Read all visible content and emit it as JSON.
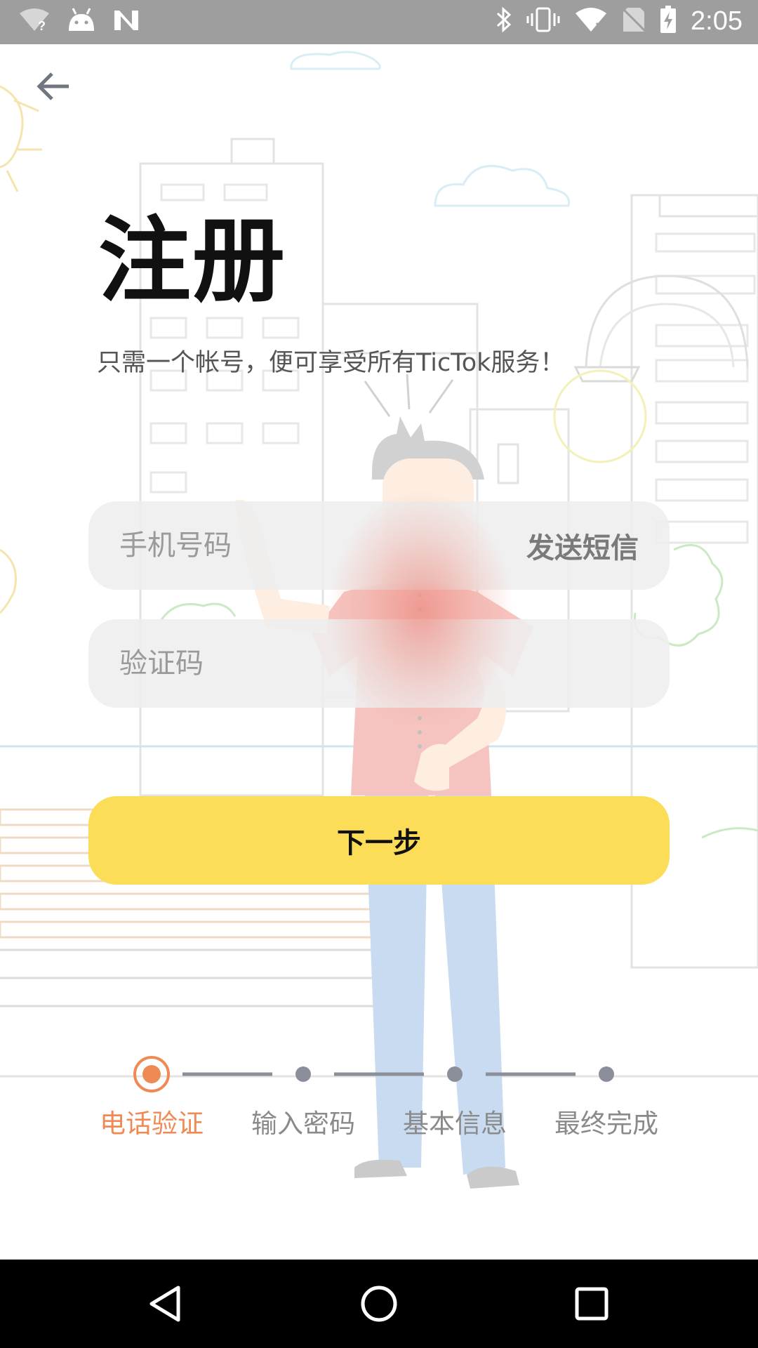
{
  "status_bar": {
    "time": "2:05",
    "icons": [
      "wifi-question-icon",
      "android-icon",
      "n-icon",
      "bluetooth-icon",
      "vibrate-icon",
      "wifi-off-icon",
      "no-sim-icon",
      "battery-charging-icon"
    ]
  },
  "header": {
    "back_icon": "arrow-left-icon",
    "title": "注册",
    "subtitle": "只需一个帐号，便可享受所有TicTok服务！"
  },
  "form": {
    "phone_placeholder": "手机号码",
    "send_sms_label": "发送短信",
    "code_placeholder": "验证码"
  },
  "next_button_label": "下一步",
  "steps": {
    "items": [
      {
        "label": "电话验证",
        "active": true
      },
      {
        "label": "输入密码",
        "active": false
      },
      {
        "label": "基本信息",
        "active": false
      },
      {
        "label": "最终完成",
        "active": false
      }
    ]
  },
  "colors": {
    "accent_yellow": "#fbdd58",
    "step_active": "#f08a55",
    "step_inactive": "#8a8f99"
  },
  "nav": {
    "back_icon": "nav-back-icon",
    "home_icon": "nav-home-icon",
    "recents_icon": "nav-recents-icon"
  }
}
